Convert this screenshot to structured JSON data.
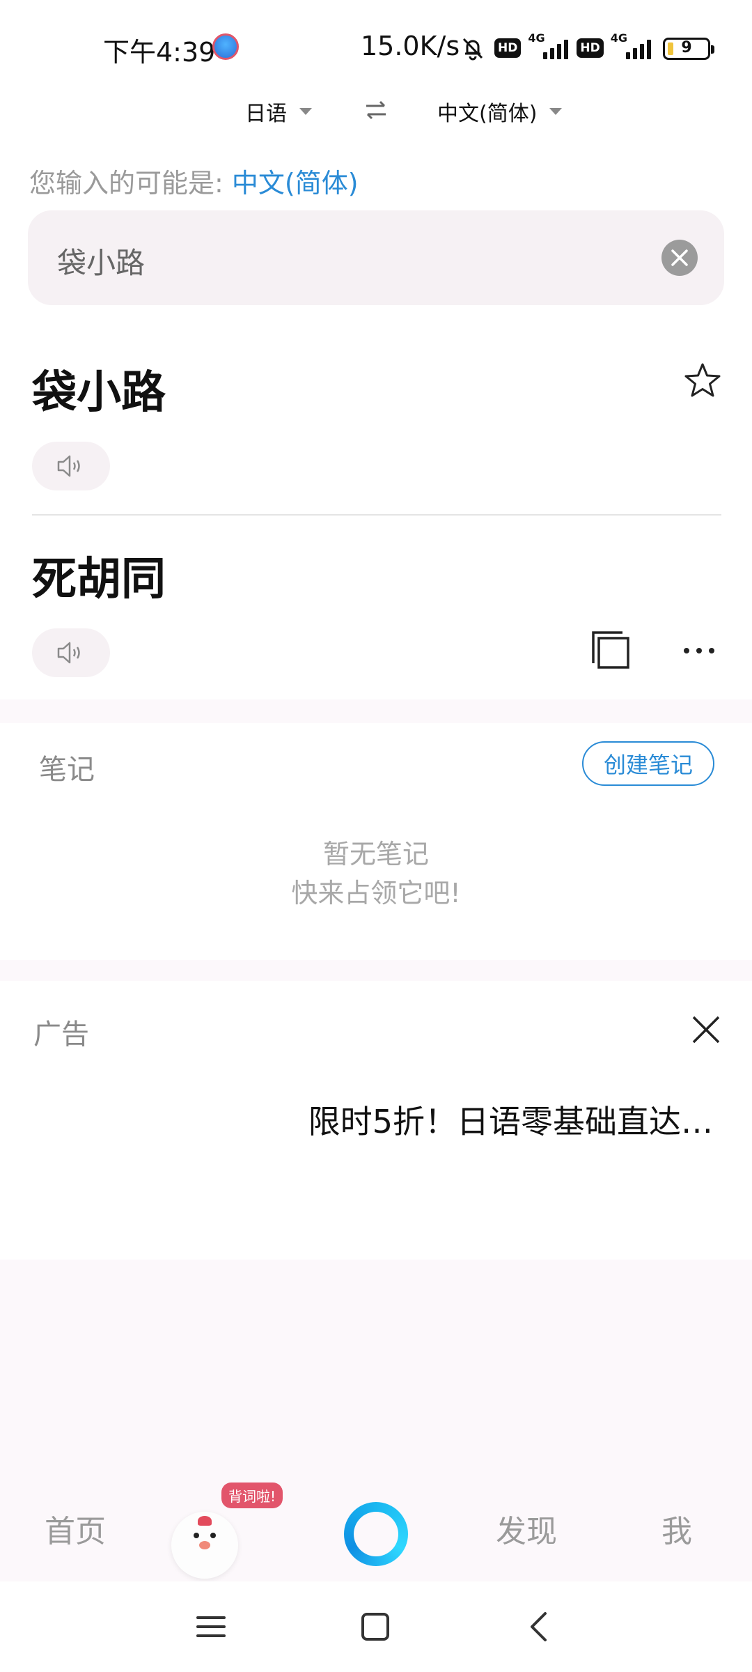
{
  "status_bar": {
    "time": "下午4:39",
    "net_speed": "15.0K/s",
    "hd_label": "HD",
    "network": "4G",
    "battery": "9"
  },
  "language": {
    "source": "日语",
    "target": "中文(简体)"
  },
  "hint": {
    "prefix": "您输入的可能是:",
    "detected_language": "中文(简体)"
  },
  "search": {
    "value": "袋小路"
  },
  "results": [
    {
      "word": "袋小路"
    },
    {
      "word": "死胡同"
    }
  ],
  "notes": {
    "title": "笔记",
    "create_button": "创建笔记",
    "empty_line1": "暂无笔记",
    "empty_line2": "快来占领它吧!"
  },
  "ad": {
    "label": "广告",
    "text": "限时5折！日语零基础直达…"
  },
  "bottom_nav": {
    "home": "首页",
    "badge": "背词啦!",
    "discover": "发现",
    "me": "我"
  },
  "colors": {
    "accent": "#2a8bd6",
    "panel_bg": "#f6f1f4",
    "badge": "#e2556b"
  }
}
